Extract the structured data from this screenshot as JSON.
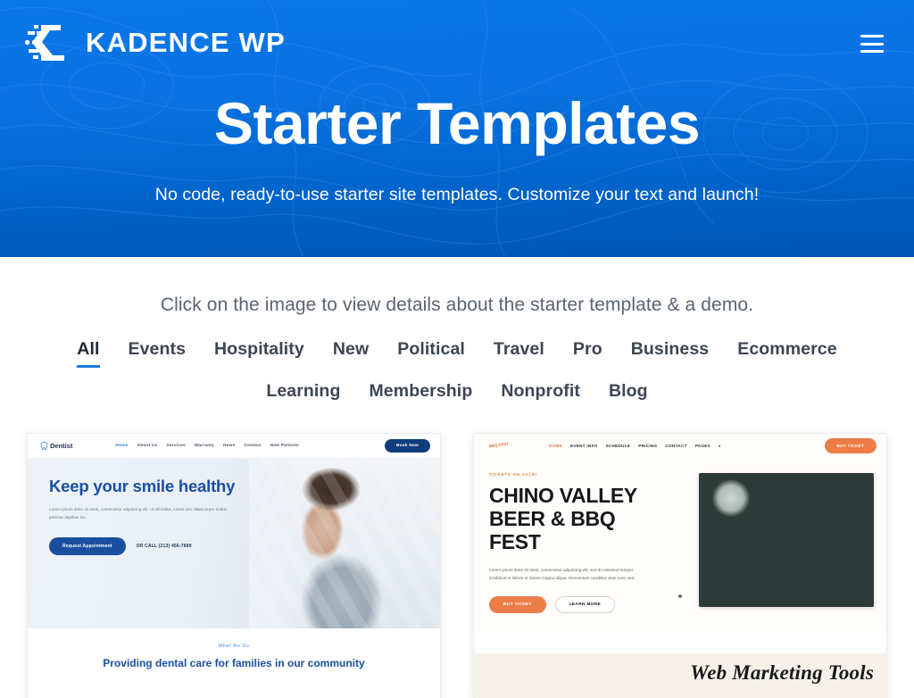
{
  "brand": {
    "name_primary": "KADENCE",
    "name_secondary": "WP",
    "logo_icon": "kadence-k-mark-icon"
  },
  "header": {
    "menu_icon": "hamburger-menu-icon",
    "title": "Starter Templates",
    "subtitle": "No code, ready-to-use starter site templates. Customize your text and launch!",
    "bg_color_top": "#0a77e8",
    "bg_color_bottom": "#0056b2",
    "pattern": "topographic-contour-lines"
  },
  "main": {
    "lead": "Click on the image to view details about the starter template & a demo.",
    "active_filter": "All",
    "accent_color": "#1f7ae0",
    "filters_row1": [
      {
        "label": "All",
        "active": true
      },
      {
        "label": "Events",
        "active": false
      },
      {
        "label": "Hospitality",
        "active": false
      },
      {
        "label": "New",
        "active": false
      },
      {
        "label": "Political",
        "active": false
      },
      {
        "label": "Travel",
        "active": false
      },
      {
        "label": "Pro",
        "active": false
      },
      {
        "label": "Business",
        "active": false
      },
      {
        "label": "Ecommerce",
        "active": false
      }
    ],
    "filters_row2": [
      {
        "label": "Learning",
        "active": false
      },
      {
        "label": "Membership",
        "active": false
      },
      {
        "label": "Nonprofit",
        "active": false
      },
      {
        "label": "Blog",
        "active": false
      }
    ]
  },
  "cards": [
    {
      "id": "dentist",
      "logo": "Dentist",
      "logo_icon": "tooth-icon",
      "nav": [
        "Home",
        "About Us",
        "Services",
        "Warranty",
        "News",
        "Contact",
        "New Patients"
      ],
      "nav_active": "Home",
      "nav_button": "Book Now",
      "heading": "Keep your smile healthy",
      "paragraph": "Lorem ipsum dolor sit amet, consectetur adipiscing elit. Ut elit tellus, luctus nec ullamcorper mattis, pulvinar dapibus leo.",
      "cta_primary": "Request Appointment",
      "cta_phone": "OR CALL (213) 456-7889",
      "footer_eyebrow": "What We Do",
      "footer_heading": "Providing dental care for families in our community",
      "accent_color": "#1a4fa0",
      "photo_alt": "dental-hygienist-photo"
    },
    {
      "id": "bbq-fest",
      "logo": "BBQ FEST",
      "logo_icon": "bbq-badge-icon",
      "nav": [
        "HOME",
        "EVENT INFO",
        "SCHEDULE",
        "PRICING",
        "CONTACT",
        "PAGES"
      ],
      "nav_active": "HOME",
      "nav_dropdown_icon": "chevron-down-icon",
      "nav_button": "BUY TICKET",
      "eyebrow": "TICKETS ON SALE!",
      "heading": "CHINO VALLEY BEER & BBQ FEST",
      "paragraph": "Lorem ipsum dolor sit amet, consectetur adipiscing elit, sed do eiusmod tempor incididunt ut labore et dolore magna aliqua. Elementum curabitur vitae nunc sed.",
      "cta_primary": "BUY TICKET",
      "cta_secondary": "LEARN MORE",
      "footer_heading": "Web Marketing Tools",
      "accent_color": "#ed7d47",
      "photo_alt": "bbq-meat-cutting-board-photo"
    }
  ]
}
